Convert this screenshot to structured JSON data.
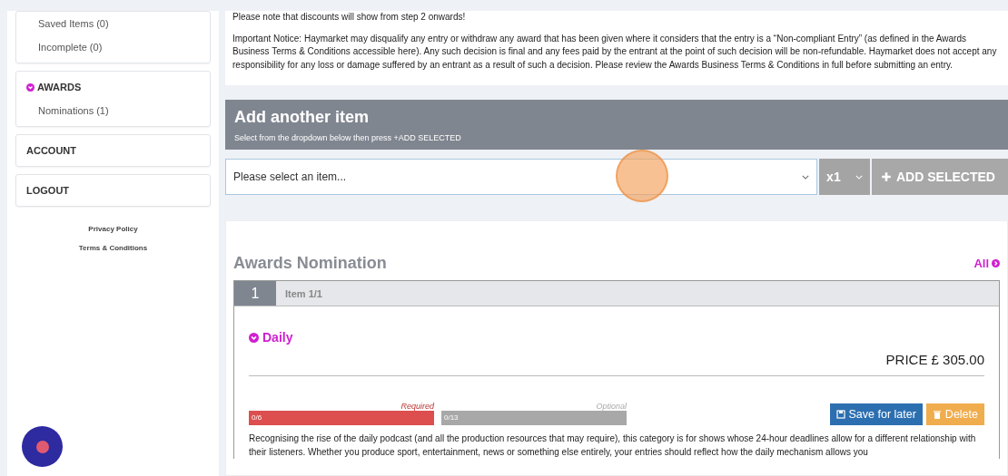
{
  "sidebar": {
    "entries_items": [
      "Saved Items (0)",
      "Incomplete (0)"
    ],
    "groups": [
      {
        "title": "AWARDS",
        "expanded": true,
        "items": [
          "Nominations (1)"
        ]
      },
      {
        "title": "ACCOUNT",
        "expanded": false
      },
      {
        "title": "LOGOUT",
        "expanded": false
      }
    ],
    "links": [
      "Privacy Policy",
      "Terms & Conditions"
    ]
  },
  "notice": {
    "lines": [
      "Please note that discounts will show from step 2 onwards!",
      "Important Notice: Haymarket may disqualify any entry or withdraw any award that has been given where it considers that the entry is a “Non-compliant Entry” (as defined in the Awards Business Terms & Conditions accessible here). Any such decision is final and any fees paid by the entrant at the point of such decision will be non-refundable. Haymarket does not accept any responsibility for any loss or damage suffered by an entrant as a result of such a decision. Please review the Awards Business Terms & Conditions in full before submitting an entry."
    ]
  },
  "add_item": {
    "title": "Add another item",
    "subtitle": "Select from the dropdown below then press +ADD SELECTED",
    "select": {
      "placeholder": "Please select an item..."
    },
    "quantity": "x1",
    "button": {
      "label": "ADD SELECTED",
      "disabled": true
    }
  },
  "nomination": {
    "title": "Awards Nomination",
    "all_link": "All",
    "item_number": "1",
    "item_label": "Item 1/1",
    "category": "Daily",
    "price": "PRICE £ 305.00",
    "progress": [
      {
        "kind": "required",
        "label": "Required",
        "count": "0/6",
        "level": 0
      },
      {
        "kind": "optional",
        "label": "Optional",
        "count": "0/13",
        "level": 0
      }
    ],
    "buttons": [
      {
        "kind": "save",
        "label": "Save for later"
      },
      {
        "kind": "delete",
        "label": "Delete"
      }
    ],
    "description": "Recognising the rise of the daily podcast (and all the production resources that may require), this category is for shows whose 24-hour deadlines allow for a different relationship with their listeners. Whether you produce sport, entertainment, news or something else entirely, your entries should reflect how the daily mechanism allows you"
  }
}
